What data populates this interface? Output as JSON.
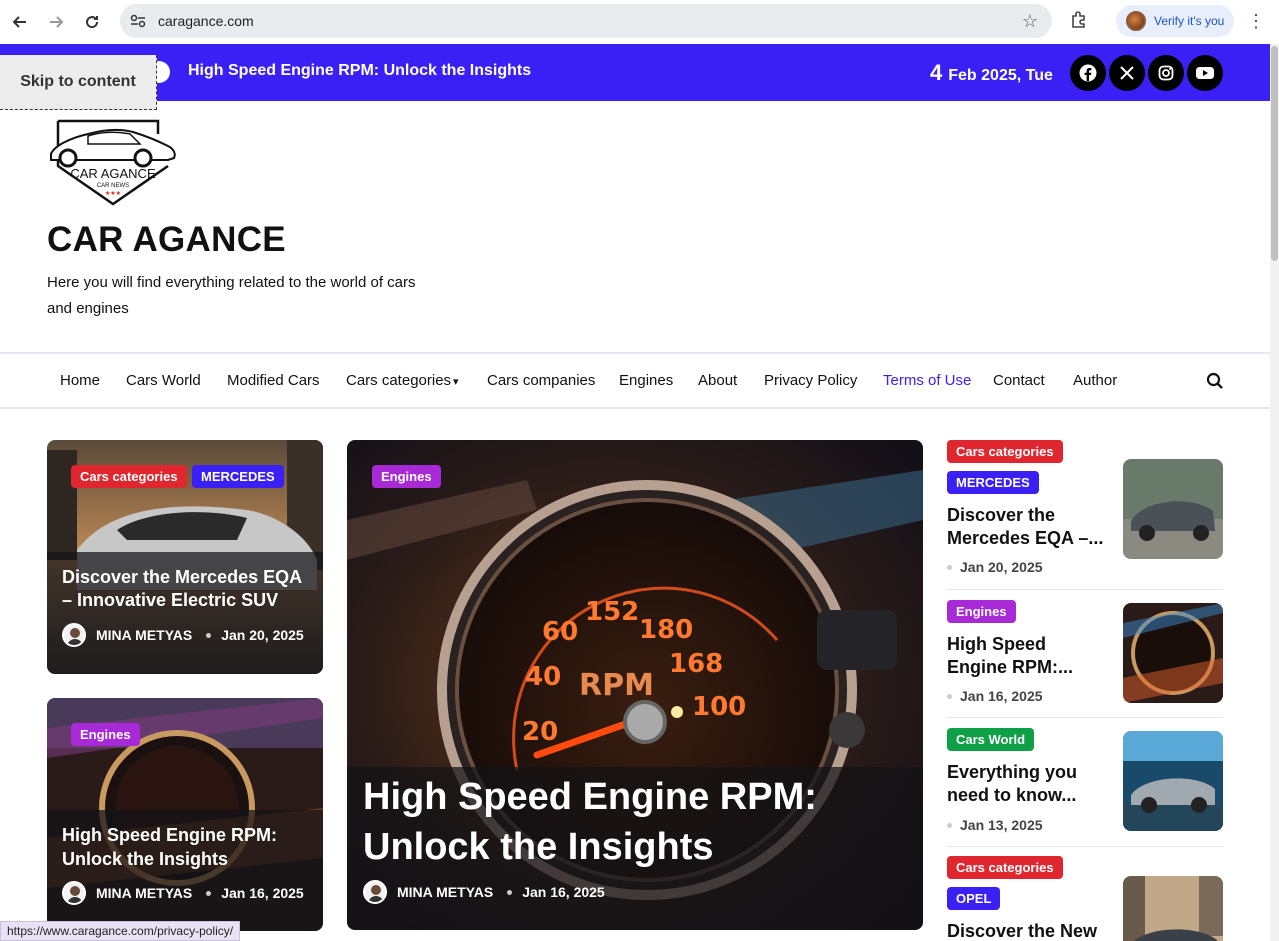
{
  "browser": {
    "url": "caragance.com",
    "verify_label": "Verify it's you"
  },
  "topbar": {
    "ticker": "High Speed Engine RPM: Unlock the Insights",
    "date_day": "4",
    "date_rest": "Feb 2025, Tue",
    "social": [
      "facebook-icon",
      "x-icon",
      "instagram-icon",
      "youtube-icon"
    ]
  },
  "skip_link": "Skip to content",
  "logo": {
    "brand": "CAR AGANCE",
    "sub": "CAR NEWS",
    "stars": "★★★"
  },
  "header": {
    "title": "CAR AGANCE",
    "description": "Here you will find everything related to the world of cars and engines"
  },
  "nav": {
    "items": [
      "Home",
      "Cars World",
      "Modified Cars",
      "Cars categories",
      "Cars companies",
      "Engines",
      "About",
      "Privacy Policy",
      "Terms of Use",
      "Contact",
      "Author"
    ],
    "caret": "▾"
  },
  "cards": {
    "left_top": {
      "tags": [
        "Cars categories",
        "MERCEDES"
      ],
      "title": "Discover the Mercedes EQA – Innovative Electric SUV",
      "author": "MINA METYAS",
      "date": "Jan 20, 2025"
    },
    "left_bottom": {
      "tags": [
        "Engines"
      ],
      "title": "High Speed Engine RPM: Unlock the Insights",
      "author": "MINA METYAS",
      "date": "Jan 16, 2025"
    },
    "main": {
      "tags": [
        "Engines"
      ],
      "title": "High Speed Engine RPM: Unlock the Insights",
      "author": "MINA METYAS",
      "date": "Jan 16, 2025",
      "gauge": {
        "label": "RPM",
        "ticks": [
          "20",
          "40",
          "60",
          "152",
          "180",
          "168",
          "100"
        ]
      }
    }
  },
  "sidebar": [
    {
      "tags": [
        "Cars categories",
        "MERCEDES"
      ],
      "title": "Discover the Mercedes EQA –...",
      "date": "Jan 20, 2025"
    },
    {
      "tags": [
        "Engines"
      ],
      "title": "High Speed Engine RPM:...",
      "date": "Jan 16, 2025"
    },
    {
      "tags": [
        "Cars World"
      ],
      "title": "Everything you need to know...",
      "date": "Jan 13, 2025"
    },
    {
      "tags": [
        "Cars categories",
        "OPEL"
      ],
      "title": "Discover the New",
      "date": ""
    }
  ],
  "status_bar": "https://www.caragance.com/privacy-policy/",
  "colors": {
    "brand_purple": "#3b20f5",
    "tag_red": "#e0262f",
    "tag_purple": "#a829d6",
    "tag_green": "#0f9f46"
  }
}
